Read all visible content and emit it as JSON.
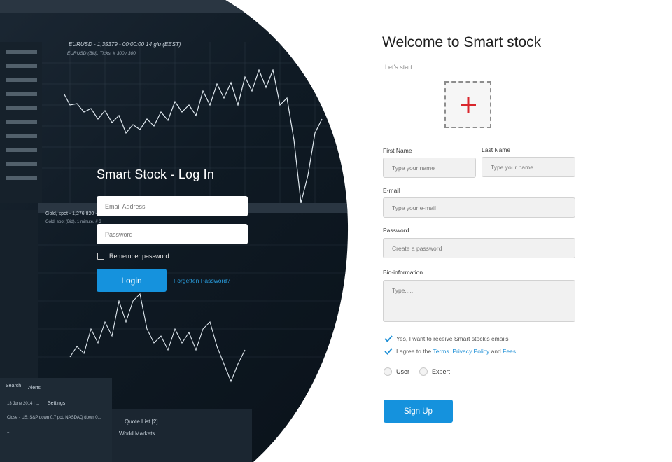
{
  "background": {
    "header_text": "EURUSD - 1,35379 - 00:00:00 14 giu (EEST)",
    "subheader_text": "EURUSD (Bid), Ticks, # 300 / 300",
    "gold_header": "Gold, spot - 1,276.820 - 12:07:52",
    "gold_subheader": "Gold, spot (Bid), 1 minute, # 3",
    "tabs": [
      "Search",
      "Alerts",
      "Settings"
    ],
    "quote_list": "Quote List [2]",
    "world_markets": "World Markets",
    "news": [
      "13 June 2014 | ...",
      "Close - US: S&P down 0.7 pct, NASDAQ down 0...",
      "..."
    ]
  },
  "login": {
    "title": "Smart Stock - Log In",
    "email_placeholder": "Email Address",
    "password_placeholder": "Password",
    "remember_label": "Remember password",
    "button_label": "Login",
    "forgot_label": "Forgetten Password?"
  },
  "signup": {
    "title": "Welcome to Smart stock",
    "subtitle": "Let's start .....",
    "upload_icon": "plus-icon",
    "upload_color": "#d9262c",
    "first_name_label": "First Name",
    "first_name_placeholder": "Type your name",
    "last_name_label": "Last Name",
    "last_name_placeholder": "Type your name",
    "email_label": "E-mail",
    "email_placeholder": "Type your e-mail",
    "password_label": "Password",
    "password_placeholder": "Create a password",
    "bio_label": "Bio-information",
    "bio_placeholder": "Type.....",
    "emails_check_label": "Yes, I want to receive Smart stock's emails",
    "agree_prefix": "I agree to the ",
    "terms_link": "Terms",
    "privacy_link": "Privacy Policy",
    "and_text": " and ",
    "fees_link": "Fees",
    "role_user": "User",
    "role_expert": "Expert",
    "button_label": "Sign Up",
    "accent_color": "#1592dd"
  }
}
